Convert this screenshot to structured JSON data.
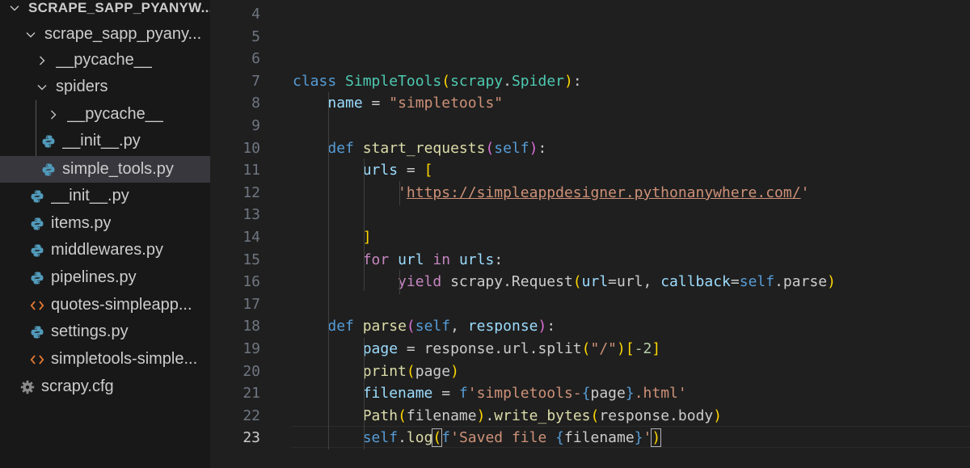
{
  "explorer": {
    "items": [
      {
        "label": "SCRAPE_SAPP_PYANYW...",
        "type": "folder-open",
        "icon": "chevron-down-icon"
      },
      {
        "label": "scrape_sapp_pyany...",
        "type": "folder-open",
        "icon": "chevron-down-icon"
      },
      {
        "label": "__pycache__",
        "type": "folder-closed",
        "icon": "chevron-right-icon"
      },
      {
        "label": "spiders",
        "type": "folder-open",
        "icon": "chevron-down-icon"
      },
      {
        "label": "__pycache__",
        "type": "folder-closed",
        "icon": "chevron-right-icon"
      },
      {
        "label": "__init__.py",
        "type": "python-file",
        "icon": "python-icon"
      },
      {
        "label": "simple_tools.py",
        "type": "python-file",
        "icon": "python-icon",
        "selected": true
      },
      {
        "label": "__init__.py",
        "type": "python-file",
        "icon": "python-icon"
      },
      {
        "label": "items.py",
        "type": "python-file",
        "icon": "python-icon"
      },
      {
        "label": "middlewares.py",
        "type": "python-file",
        "icon": "python-icon"
      },
      {
        "label": "pipelines.py",
        "type": "python-file",
        "icon": "python-icon"
      },
      {
        "label": "quotes-simpleapp...",
        "type": "html-file",
        "icon": "html-icon"
      },
      {
        "label": "settings.py",
        "type": "python-file",
        "icon": "python-icon"
      },
      {
        "label": "simpletools-simple...",
        "type": "html-file",
        "icon": "html-icon"
      },
      {
        "label": "scrapy.cfg",
        "type": "config-file",
        "icon": "gear-icon"
      }
    ]
  },
  "editor": {
    "active_line": "23",
    "lines": [
      {
        "number": "4",
        "tokens": []
      },
      {
        "number": "5",
        "tokens": []
      },
      {
        "number": "6",
        "tokens": []
      },
      {
        "number": "7",
        "tokens": [
          {
            "text": "class",
            "cls": "t-kw"
          },
          {
            "text": " "
          },
          {
            "text": "SimpleTools",
            "cls": "t-cls"
          },
          {
            "text": "(",
            "cls": "t-b1"
          },
          {
            "text": "scrapy",
            "cls": "t-cls"
          },
          {
            "text": "."
          },
          {
            "text": "Spider",
            "cls": "t-cls"
          },
          {
            "text": ")",
            "cls": "t-b1"
          },
          {
            "text": ":"
          }
        ]
      },
      {
        "number": "8",
        "tokens": [
          {
            "text": "    "
          },
          {
            "text": "name",
            "cls": "t-var"
          },
          {
            "text": " = "
          },
          {
            "text": "\"simpletools\"",
            "cls": "t-str"
          }
        ]
      },
      {
        "number": "9",
        "tokens": []
      },
      {
        "number": "10",
        "tokens": [
          {
            "text": "    "
          },
          {
            "text": "def",
            "cls": "t-kw"
          },
          {
            "text": " "
          },
          {
            "text": "start_requests",
            "cls": "t-fn"
          },
          {
            "text": "(",
            "cls": "t-b2"
          },
          {
            "text": "self",
            "cls": "t-kw"
          },
          {
            "text": ")",
            "cls": "t-b2"
          },
          {
            "text": ":"
          }
        ]
      },
      {
        "number": "11",
        "tokens": [
          {
            "text": "        "
          },
          {
            "text": "urls",
            "cls": "t-var"
          },
          {
            "text": " = "
          },
          {
            "text": "[",
            "cls": "t-b1"
          }
        ]
      },
      {
        "number": "12",
        "tokens": [
          {
            "text": "            "
          },
          {
            "text": "'",
            "cls": "t-str"
          },
          {
            "text": "https://simpleappdesigner.pythonanywhere.com/",
            "cls": "t-str t-url"
          },
          {
            "text": "'",
            "cls": "t-str"
          }
        ]
      },
      {
        "number": "13",
        "tokens": []
      },
      {
        "number": "14",
        "tokens": [
          {
            "text": "        "
          },
          {
            "text": "]",
            "cls": "t-b1"
          }
        ]
      },
      {
        "number": "15",
        "tokens": [
          {
            "text": "        "
          },
          {
            "text": "for",
            "cls": "t-ctl"
          },
          {
            "text": " "
          },
          {
            "text": "url",
            "cls": "t-var"
          },
          {
            "text": " "
          },
          {
            "text": "in",
            "cls": "t-ctl"
          },
          {
            "text": " "
          },
          {
            "text": "urls",
            "cls": "t-var"
          },
          {
            "text": ":"
          }
        ]
      },
      {
        "number": "16",
        "tokens": [
          {
            "text": "            "
          },
          {
            "text": "yield",
            "cls": "t-ctl"
          },
          {
            "text": " scrapy.Request"
          },
          {
            "text": "(",
            "cls": "t-b1"
          },
          {
            "text": "url",
            "cls": "t-var"
          },
          {
            "text": "=url, "
          },
          {
            "text": "callback",
            "cls": "t-var"
          },
          {
            "text": "="
          },
          {
            "text": "self",
            "cls": "t-kw"
          },
          {
            "text": ".parse"
          },
          {
            "text": ")",
            "cls": "t-b1"
          }
        ]
      },
      {
        "number": "17",
        "tokens": []
      },
      {
        "number": "18",
        "tokens": [
          {
            "text": "    "
          },
          {
            "text": "def",
            "cls": "t-kw"
          },
          {
            "text": " "
          },
          {
            "text": "parse",
            "cls": "t-fn"
          },
          {
            "text": "(",
            "cls": "t-b2"
          },
          {
            "text": "self",
            "cls": "t-kw"
          },
          {
            "text": ", "
          },
          {
            "text": "response",
            "cls": "t-var"
          },
          {
            "text": ")",
            "cls": "t-b2"
          },
          {
            "text": ":"
          }
        ]
      },
      {
        "number": "19",
        "tokens": [
          {
            "text": "        "
          },
          {
            "text": "page",
            "cls": "t-var"
          },
          {
            "text": " = response.url.split"
          },
          {
            "text": "(",
            "cls": "t-b1"
          },
          {
            "text": "\"/\"",
            "cls": "t-str"
          },
          {
            "text": ")",
            "cls": "t-b1"
          },
          {
            "text": "[",
            "cls": "t-b1"
          },
          {
            "text": "-2",
            "cls": "t-num"
          },
          {
            "text": "]",
            "cls": "t-b1"
          }
        ]
      },
      {
        "number": "20",
        "tokens": [
          {
            "text": "        "
          },
          {
            "text": "print",
            "cls": "t-fn"
          },
          {
            "text": "(",
            "cls": "t-b1"
          },
          {
            "text": "page"
          },
          {
            "text": ")",
            "cls": "t-b1"
          }
        ]
      },
      {
        "number": "21",
        "tokens": [
          {
            "text": "        "
          },
          {
            "text": "filename",
            "cls": "t-var"
          },
          {
            "text": " = "
          },
          {
            "text": "f",
            "cls": "t-kw"
          },
          {
            "text": "'simpletools-",
            "cls": "t-str"
          },
          {
            "text": "{",
            "cls": "t-kw"
          },
          {
            "text": "page"
          },
          {
            "text": "}",
            "cls": "t-kw"
          },
          {
            "text": ".html'",
            "cls": "t-str"
          }
        ]
      },
      {
        "number": "22",
        "tokens": [
          {
            "text": "        "
          },
          {
            "text": "Path",
            "cls": "t-fn"
          },
          {
            "text": "(",
            "cls": "t-b1"
          },
          {
            "text": "filename"
          },
          {
            "text": ")",
            "cls": "t-b1"
          },
          {
            "text": "."
          },
          {
            "text": "write_bytes",
            "cls": "t-fn"
          },
          {
            "text": "(",
            "cls": "t-b1"
          },
          {
            "text": "response.body"
          },
          {
            "text": ")",
            "cls": "t-b1"
          }
        ]
      },
      {
        "number": "23",
        "tokens": [
          {
            "text": "        "
          },
          {
            "text": "self",
            "cls": "t-kw"
          },
          {
            "text": "."
          },
          {
            "text": "log",
            "cls": "t-fn"
          },
          {
            "text": "(",
            "cls": "t-b1 bracket-match"
          },
          {
            "text": "f",
            "cls": "t-kw"
          },
          {
            "text": "'Saved file ",
            "cls": "t-str"
          },
          {
            "text": "{",
            "cls": "t-kw"
          },
          {
            "text": "filename"
          },
          {
            "text": "}",
            "cls": "t-kw"
          },
          {
            "text": "'",
            "cls": "t-str"
          },
          {
            "text": ")",
            "cls": "t-b1 bracket-match"
          }
        ]
      }
    ]
  }
}
